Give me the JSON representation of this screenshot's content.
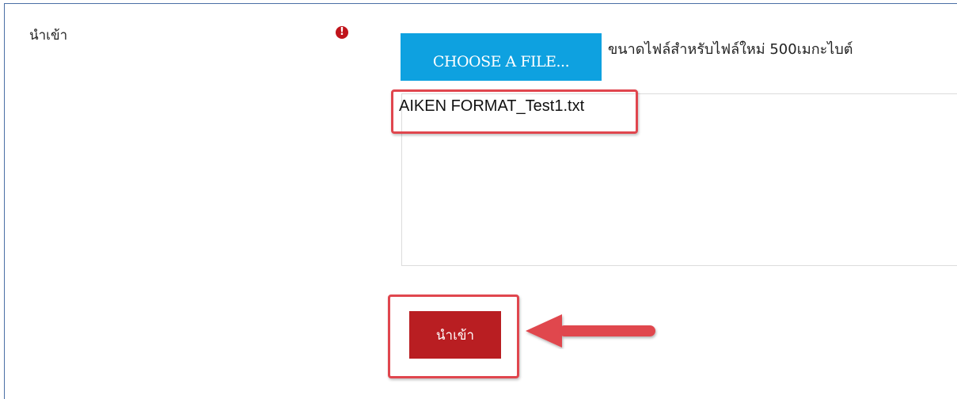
{
  "form": {
    "field_label": "นำเข้า",
    "required_icon": "!",
    "choose_button_label": "CHOOSE A FILE...",
    "max_size_text": "ขนาดไฟล์สำหรับไฟล์ใหม่ 500เมกะไบต์",
    "selected_file": "AIKEN FORMAT_Test1.txt",
    "import_button_label": "นำเข้า"
  },
  "colors": {
    "choose_button": "#0ea1e0",
    "import_button": "#b91e22",
    "highlight": "#e0464e",
    "required": "#c0141b"
  },
  "icons": {
    "required": "exclamation-circle-icon",
    "pointer": "arrow-left-icon"
  }
}
